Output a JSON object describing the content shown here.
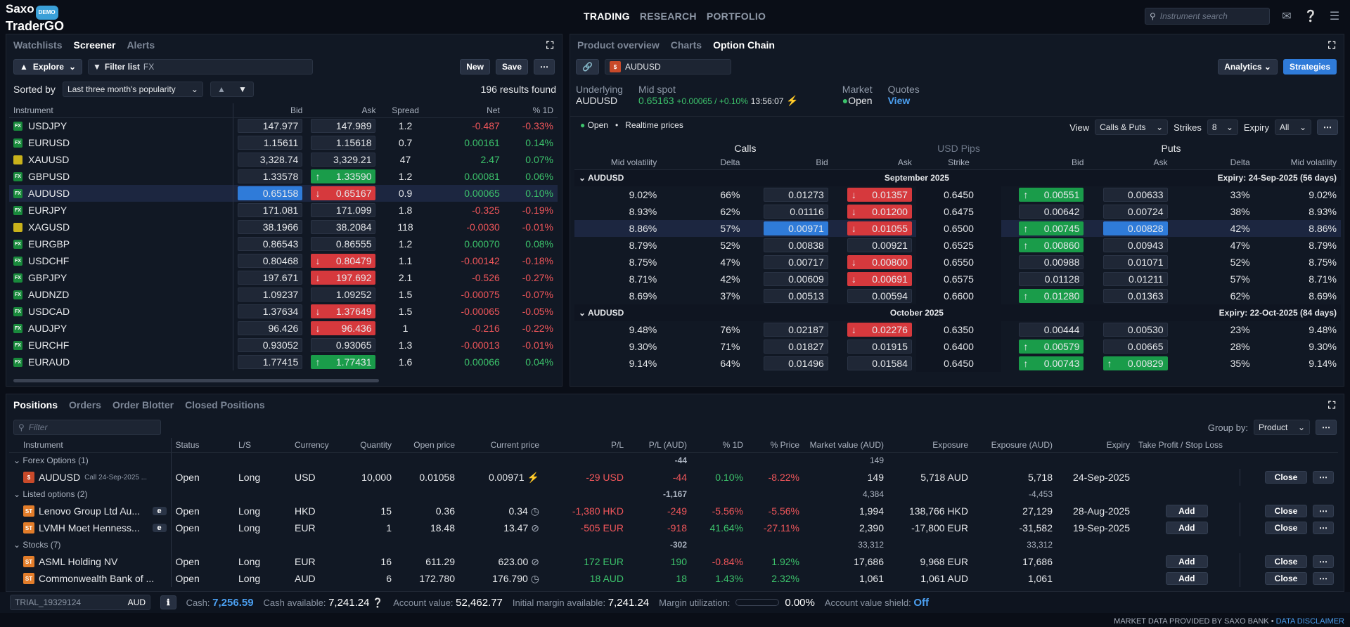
{
  "app": {
    "brand1": "Saxo",
    "brand2": "TraderGO",
    "badge": "DEMO"
  },
  "nav": {
    "items": [
      "TRADING",
      "RESEARCH",
      "PORTFOLIO"
    ],
    "active": 0
  },
  "search": {
    "placeholder": "Instrument search"
  },
  "left": {
    "tabs": [
      "Watchlists",
      "Screener",
      "Alerts"
    ],
    "active": 1,
    "explore": "Explore",
    "filter_label": "Filter list",
    "filter_value": "FX",
    "new": "New",
    "save": "Save",
    "sorted_by": "Sorted by",
    "sort_value": "Last three month's popularity",
    "results": "196 results found",
    "columns": [
      "Instrument",
      "Bid",
      "Ask",
      "Spread",
      "Net",
      "% 1D"
    ],
    "rows": [
      {
        "sym": "USDJPY",
        "icon": "fx",
        "bid": "147.977",
        "ask": "147.989",
        "spread": "1.2",
        "net": "-0.487",
        "pct": "-0.33%",
        "dir": "neg",
        "bidstate": "",
        "askstate": ""
      },
      {
        "sym": "EURUSD",
        "icon": "fx",
        "bid": "1.15611",
        "ask": "1.15618",
        "spread": "0.7",
        "net": "0.00161",
        "pct": "0.14%",
        "dir": "pos",
        "bidstate": "",
        "askstate": ""
      },
      {
        "sym": "XAUUSD",
        "icon": "gold",
        "bid": "3,328.74",
        "ask": "3,329.21",
        "spread": "47",
        "net": "2.47",
        "pct": "0.07%",
        "dir": "pos",
        "bidstate": "",
        "askstate": ""
      },
      {
        "sym": "GBPUSD",
        "icon": "fx",
        "bid": "1.33578",
        "ask": "1.33590",
        "spread": "1.2",
        "net": "0.00081",
        "pct": "0.06%",
        "dir": "pos",
        "bidstate": "",
        "askstate": "up"
      },
      {
        "sym": "AUDUSD",
        "icon": "fx",
        "bid": "0.65158",
        "ask": "0.65167",
        "spread": "0.9",
        "net": "0.00065",
        "pct": "0.10%",
        "dir": "pos",
        "bidstate": "sel",
        "askstate": "dn"
      },
      {
        "sym": "EURJPY",
        "icon": "fx",
        "bid": "171.081",
        "ask": "171.099",
        "spread": "1.8",
        "net": "-0.325",
        "pct": "-0.19%",
        "dir": "neg",
        "bidstate": "",
        "askstate": ""
      },
      {
        "sym": "XAGUSD",
        "icon": "gold",
        "bid": "38.1966",
        "ask": "38.2084",
        "spread": "118",
        "net": "-0.0030",
        "pct": "-0.01%",
        "dir": "neg",
        "bidstate": "",
        "askstate": ""
      },
      {
        "sym": "EURGBP",
        "icon": "fx",
        "bid": "0.86543",
        "ask": "0.86555",
        "spread": "1.2",
        "net": "0.00070",
        "pct": "0.08%",
        "dir": "pos",
        "bidstate": "",
        "askstate": ""
      },
      {
        "sym": "USDCHF",
        "icon": "fx",
        "bid": "0.80468",
        "ask": "0.80479",
        "spread": "1.1",
        "net": "-0.00142",
        "pct": "-0.18%",
        "dir": "neg",
        "bidstate": "",
        "askstate": "dn"
      },
      {
        "sym": "GBPJPY",
        "icon": "fx",
        "bid": "197.671",
        "ask": "197.692",
        "spread": "2.1",
        "net": "-0.526",
        "pct": "-0.27%",
        "dir": "neg",
        "bidstate": "",
        "askstate": "dn"
      },
      {
        "sym": "AUDNZD",
        "icon": "fx",
        "bid": "1.09237",
        "ask": "1.09252",
        "spread": "1.5",
        "net": "-0.00075",
        "pct": "-0.07%",
        "dir": "neg",
        "bidstate": "",
        "askstate": ""
      },
      {
        "sym": "USDCAD",
        "icon": "fx",
        "bid": "1.37634",
        "ask": "1.37649",
        "spread": "1.5",
        "net": "-0.00065",
        "pct": "-0.05%",
        "dir": "neg",
        "bidstate": "",
        "askstate": "dn"
      },
      {
        "sym": "AUDJPY",
        "icon": "fx",
        "bid": "96.426",
        "ask": "96.436",
        "spread": "1",
        "net": "-0.216",
        "pct": "-0.22%",
        "dir": "neg",
        "bidstate": "",
        "askstate": "dn"
      },
      {
        "sym": "EURCHF",
        "icon": "fx",
        "bid": "0.93052",
        "ask": "0.93065",
        "spread": "1.3",
        "net": "-0.00013",
        "pct": "-0.01%",
        "dir": "neg",
        "bidstate": "",
        "askstate": ""
      },
      {
        "sym": "EURAUD",
        "icon": "fx",
        "bid": "1.77415",
        "ask": "1.77431",
        "spread": "1.6",
        "net": "0.00066",
        "pct": "0.04%",
        "dir": "pos",
        "bidstate": "",
        "askstate": "up"
      }
    ]
  },
  "right": {
    "tabs": [
      "Product overview",
      "Charts",
      "Option Chain"
    ],
    "active": 2,
    "instrument": "AUDUSD",
    "analytics": "Analytics",
    "strategies": "Strategies",
    "underlying_label": "Underlying",
    "underlying": "AUDUSD",
    "midspot_label": "Mid spot",
    "midspot": "0.65163",
    "midspot_chg": "+0.00065 / +0.10%",
    "midspot_time": "13:56:07",
    "market_label": "Market",
    "market": "Open",
    "quotes_label": "Quotes",
    "quotes": "View",
    "status": "Open",
    "realtime": "Realtime prices",
    "view_label": "View",
    "view": "Calls & Puts",
    "strikes_label": "Strikes",
    "strikes": "8",
    "expiry_label": "Expiry",
    "expiry": "All",
    "calls": "Calls",
    "pips": "USD Pips",
    "puts": "Puts",
    "columns": [
      "Mid volatility",
      "Delta",
      "Bid",
      "Ask",
      "Strike",
      "Bid",
      "Ask",
      "Delta",
      "Mid volatility"
    ],
    "sections": [
      {
        "sym": "AUDUSD",
        "month": "September 2025",
        "expiry": "Expiry: 24-Sep-2025 (56 days)",
        "rows": [
          {
            "cv": "9.02%",
            "cd": "66%",
            "cb": "0.01273",
            "ca": "0.01357",
            "cbs": "",
            "cas": "dn",
            "k": "0.6450",
            "pb": "0.00551",
            "pa": "0.00633",
            "pbs": "up",
            "pas": "",
            "pd": "33%",
            "pv": "9.02%"
          },
          {
            "cv": "8.93%",
            "cd": "62%",
            "cb": "0.01116",
            "ca": "0.01200",
            "cbs": "",
            "cas": "dn",
            "k": "0.6475",
            "pb": "0.00642",
            "pa": "0.00724",
            "pbs": "",
            "pas": "",
            "pd": "38%",
            "pv": "8.93%"
          },
          {
            "cv": "8.86%",
            "cd": "57%",
            "cb": "0.00971",
            "ca": "0.01055",
            "cbs": "sel",
            "cas": "dn",
            "k": "0.6500",
            "pb": "0.00745",
            "pa": "0.00828",
            "pbs": "up",
            "pas": "sel",
            "pd": "42%",
            "pv": "8.86%"
          },
          {
            "cv": "8.79%",
            "cd": "52%",
            "cb": "0.00838",
            "ca": "0.00921",
            "cbs": "",
            "cas": "",
            "k": "0.6525",
            "pb": "0.00860",
            "pa": "0.00943",
            "pbs": "up",
            "pas": "",
            "pd": "47%",
            "pv": "8.79%"
          },
          {
            "cv": "8.75%",
            "cd": "47%",
            "cb": "0.00717",
            "ca": "0.00800",
            "cbs": "",
            "cas": "dn",
            "k": "0.6550",
            "pb": "0.00988",
            "pa": "0.01071",
            "pbs": "",
            "pas": "",
            "pd": "52%",
            "pv": "8.75%"
          },
          {
            "cv": "8.71%",
            "cd": "42%",
            "cb": "0.00609",
            "ca": "0.00691",
            "cbs": "",
            "cas": "dn",
            "k": "0.6575",
            "pb": "0.01128",
            "pa": "0.01211",
            "pbs": "",
            "pas": "",
            "pd": "57%",
            "pv": "8.71%"
          },
          {
            "cv": "8.69%",
            "cd": "37%",
            "cb": "0.00513",
            "ca": "0.00594",
            "cbs": "",
            "cas": "",
            "k": "0.6600",
            "pb": "0.01280",
            "pa": "0.01363",
            "pbs": "up",
            "pas": "",
            "pd": "62%",
            "pv": "8.69%"
          }
        ]
      },
      {
        "sym": "AUDUSD",
        "month": "October 2025",
        "expiry": "Expiry: 22-Oct-2025 (84 days)",
        "rows": [
          {
            "cv": "9.48%",
            "cd": "76%",
            "cb": "0.02187",
            "ca": "0.02276",
            "cbs": "",
            "cas": "dn",
            "k": "0.6350",
            "pb": "0.00444",
            "pa": "0.00530",
            "pbs": "",
            "pas": "",
            "pd": "23%",
            "pv": "9.48%"
          },
          {
            "cv": "9.30%",
            "cd": "71%",
            "cb": "0.01827",
            "ca": "0.01915",
            "cbs": "",
            "cas": "",
            "k": "0.6400",
            "pb": "0.00579",
            "pa": "0.00665",
            "pbs": "up",
            "pas": "",
            "pd": "28%",
            "pv": "9.30%"
          },
          {
            "cv": "9.14%",
            "cd": "64%",
            "cb": "0.01496",
            "ca": "0.01584",
            "cbs": "",
            "cas": "",
            "k": "0.6450",
            "pb": "0.00743",
            "pa": "0.00829",
            "pbs": "up",
            "pas": "up",
            "pd": "35%",
            "pv": "9.14%"
          }
        ]
      }
    ]
  },
  "bottom": {
    "tabs": [
      "Positions",
      "Orders",
      "Order Blotter",
      "Closed Positions"
    ],
    "active": 0,
    "filter_placeholder": "Filter",
    "groupby_label": "Group by:",
    "groupby": "Product",
    "columns": [
      "Instrument",
      "Status",
      "L/S",
      "Currency",
      "Quantity",
      "Open price",
      "Current price",
      "P/L",
      "P/L (AUD)",
      "% 1D",
      "% Price",
      "Market value (AUD)",
      "Exposure",
      "Exposure (AUD)",
      "Expiry",
      "Take Profit / Stop Loss"
    ],
    "groups": [
      {
        "name": "Forex Options (1)",
        "pl_aud": "-44",
        "mv": "149",
        "exp_aud": "",
        "rows": [
          {
            "inst": "AUDUSD",
            "sub": "Call 24-Sep-2025 ...",
            "icon": "fx2",
            "e": false,
            "status": "Open",
            "ls": "Long",
            "ccy": "USD",
            "qty": "10,000",
            "open": "0.01058",
            "cur": "0.00971",
            "curicon": "bolt",
            "pl": "-29 USD",
            "pld": "neg",
            "plaud": "-44",
            "pd1": "0.10%",
            "pd1d": "pos",
            "pp": "-8.22%",
            "ppd": "neg",
            "mv": "149",
            "exp": "5,718 AUD",
            "expaud": "5,718",
            "expiry": "24-Sep-2025",
            "add": false
          }
        ]
      },
      {
        "name": "Listed options (2)",
        "pl_aud": "-1,167",
        "mv": "4,384",
        "exp_aud": "-4,453",
        "rows": [
          {
            "inst": "Lenovo Group Ltd Au...",
            "sub": "",
            "icon": "st",
            "e": true,
            "status": "Open",
            "ls": "Long",
            "ccy": "HKD",
            "qty": "15",
            "open": "0.36",
            "cur": "0.34",
            "curicon": "clock",
            "pl": "-1,380 HKD",
            "pld": "neg",
            "plaud": "-249",
            "pd1": "-5.56%",
            "pd1d": "neg",
            "pp": "-5.56%",
            "ppd": "neg",
            "mv": "1,994",
            "exp": "138,766 HKD",
            "expaud": "27,129",
            "expiry": "28-Aug-2025",
            "add": true
          },
          {
            "inst": "LVMH Moet Henness...",
            "sub": "",
            "icon": "st",
            "e": true,
            "status": "Open",
            "ls": "Long",
            "ccy": "EUR",
            "qty": "1",
            "open": "18.48",
            "cur": "13.47",
            "curicon": "ban",
            "pl": "-505 EUR",
            "pld": "neg",
            "plaud": "-918",
            "pd1": "41.64%",
            "pd1d": "pos",
            "pp": "-27.11%",
            "ppd": "neg",
            "mv": "2,390",
            "exp": "-17,800 EUR",
            "expaud": "-31,582",
            "expiry": "19-Sep-2025",
            "add": true
          }
        ]
      },
      {
        "name": "Stocks (7)",
        "pl_aud": "-302",
        "mv": "33,312",
        "exp_aud": "33,312",
        "rows": [
          {
            "inst": "ASML Holding NV",
            "sub": "",
            "icon": "st",
            "e": false,
            "status": "Open",
            "ls": "Long",
            "ccy": "EUR",
            "qty": "16",
            "open": "611.29",
            "cur": "623.00",
            "curicon": "ban",
            "pl": "172 EUR",
            "pld": "pos",
            "plaud": "190",
            "pd1": "-0.84%",
            "pd1d": "neg",
            "pp": "1.92%",
            "ppd": "pos",
            "mv": "17,686",
            "exp": "9,968 EUR",
            "expaud": "17,686",
            "expiry": "",
            "add": true
          },
          {
            "inst": "Commonwealth Bank of ...",
            "sub": "",
            "icon": "st",
            "e": false,
            "status": "Open",
            "ls": "Long",
            "ccy": "AUD",
            "qty": "6",
            "open": "172.780",
            "cur": "176.790",
            "curicon": "clock",
            "pl": "18 AUD",
            "pld": "pos",
            "plaud": "18",
            "pd1": "1.43%",
            "pd1d": "pos",
            "pp": "2.32%",
            "ppd": "pos",
            "mv": "1,061",
            "exp": "1,061 AUD",
            "expaud": "1,061",
            "expiry": "",
            "add": true
          }
        ]
      }
    ],
    "add": "Add",
    "close": "Close"
  },
  "footer": {
    "account": "TRIAL_19329124",
    "ccy": "AUD",
    "cash_label": "Cash:",
    "cash": "7,256.59",
    "cash_avail_label": "Cash available:",
    "cash_avail": "7,241.24",
    "acct_val_label": "Account value:",
    "acct_val": "52,462.77",
    "margin_label": "Initial margin available:",
    "margin": "7,241.24",
    "util_label": "Margin utilization:",
    "util": "0.00%",
    "util_fraction": 0,
    "shield_label": "Account value shield:",
    "shield": "Off",
    "disclaimer": "MARKET DATA PROVIDED BY SAXO BANK •",
    "disclaimer_link": "DATA DISCLAIMER"
  },
  "colors": {
    "accent": "#2f7bd9",
    "up": "#1a9c4a",
    "down": "#d6393d",
    "pos": "#3cc26b",
    "neg": "#f0565a"
  }
}
